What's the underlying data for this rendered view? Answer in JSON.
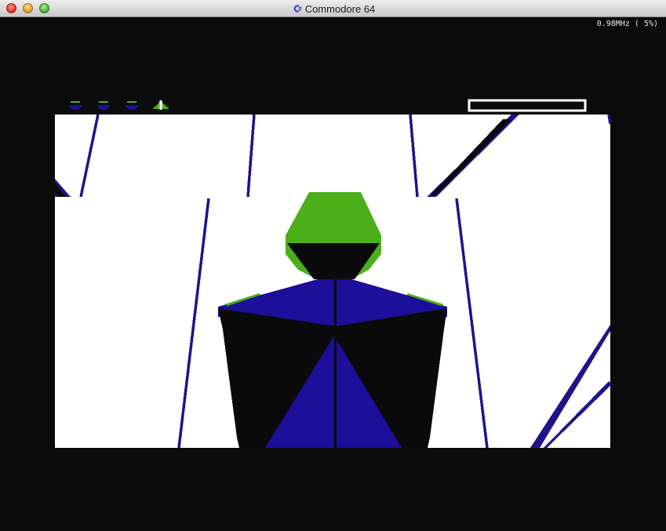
{
  "window": {
    "title": "Commodore 64"
  },
  "status": {
    "speed": "0.98MHz ( 5%)"
  },
  "hud": {
    "lives": [
      "ship-icon",
      "ship-icon",
      "ship-icon",
      "ship-icon"
    ],
    "energy_level": 0
  },
  "colors": {
    "background": "#0b0b0b",
    "floor": "#ffffff",
    "edge_line": "#1e148c",
    "robot_head": "#4caf1a",
    "robot_body_blue": "#1c0f9a",
    "robot_body_black": "#0a0a0a"
  },
  "icons": {
    "app": "commodore-logo-icon",
    "window_controls": [
      "close-icon",
      "minimize-icon",
      "zoom-icon"
    ]
  }
}
